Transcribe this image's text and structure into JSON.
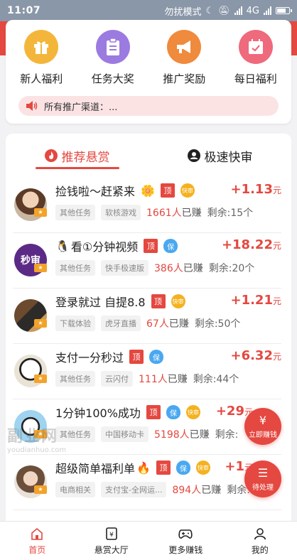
{
  "status_bar": {
    "time": "11:07",
    "dnd": "勿扰模式",
    "network": "4G"
  },
  "quick_actions": [
    {
      "label": "新人福利",
      "icon": "gift-icon",
      "color": "#f4b63a"
    },
    {
      "label": "任务大奖",
      "icon": "clipboard-icon",
      "color": "#9b7be0"
    },
    {
      "label": "推广奖励",
      "icon": "megaphone-icon",
      "color": "#f08a3c"
    },
    {
      "label": "每日福利",
      "icon": "calendar-icon",
      "color": "#ee6a7c"
    }
  ],
  "notice": {
    "text": "所有推广渠道：..."
  },
  "tabs": [
    {
      "label": "推荐悬赏",
      "active": true,
      "icon": "flame-icon"
    },
    {
      "label": "极速快审",
      "active": false,
      "icon": "user-circle-icon"
    }
  ],
  "tasks": [
    {
      "title": "捡钱啦～赶紧来",
      "emoji": "🌼",
      "badges": [
        "顶",
        "快审"
      ],
      "tags": [
        "其他任务",
        "软核游戏"
      ],
      "count": "1661人",
      "taken_suffix": "已赚",
      "remain": "剩余:15个",
      "reward": "+1.13",
      "unit": "元"
    },
    {
      "title": "看①分钟视频",
      "emoji": "🐧",
      "badges": [
        "顶",
        "保"
      ],
      "tags": [
        "其他任务",
        "快手极速版"
      ],
      "count": "386人",
      "taken_suffix": "已赚",
      "remain": "剩余:20个",
      "reward": "+18.22",
      "unit": "元"
    },
    {
      "title": "登录就过 自提8.8",
      "emoji": "",
      "badges": [
        "顶",
        "快审"
      ],
      "tags": [
        "下载体验",
        "虎牙直播"
      ],
      "count": "67人",
      "taken_suffix": "已赚",
      "remain": "剩余:50个",
      "reward": "+1.21",
      "unit": "元"
    },
    {
      "title": "支付一分秒过",
      "emoji": "",
      "badges": [
        "顶",
        "保"
      ],
      "tags": [
        "其他任务",
        "云闪付"
      ],
      "count": "111人",
      "taken_suffix": "已赚",
      "remain": "剩余:44个",
      "reward": "+6.32",
      "unit": "元"
    },
    {
      "title": "1分钟100%成功",
      "emoji": "",
      "badges": [
        "顶",
        "保",
        "快审"
      ],
      "tags": [
        "其他任务",
        "中国移动卡"
      ],
      "count": "5198人",
      "taken_suffix": "已赚",
      "remain": "剩余:",
      "reward": "+29",
      "unit": "元"
    },
    {
      "title": "超级简单福利单",
      "emoji": "🔥",
      "badges": [
        "顶",
        "保",
        "快审"
      ],
      "tags": [
        "电商相关",
        "支付宝-全网运..."
      ],
      "count": "894人",
      "taken_suffix": "已赚",
      "remain": "剩余:",
      "reward": "+1",
      "unit": "元"
    }
  ],
  "fabs": {
    "earn": "立即赚钱",
    "pending": "待处理"
  },
  "watermark": {
    "cn": "副业网",
    "en": "youdianhuo.com"
  },
  "bottom_nav": [
    {
      "label": "首页",
      "icon": "home-icon",
      "active": true
    },
    {
      "label": "悬赏大厅",
      "icon": "reward-hall-icon",
      "active": false
    },
    {
      "label": "更多赚钱",
      "icon": "gamepad-icon",
      "active": false
    },
    {
      "label": "我的",
      "icon": "profile-icon",
      "active": false
    }
  ]
}
